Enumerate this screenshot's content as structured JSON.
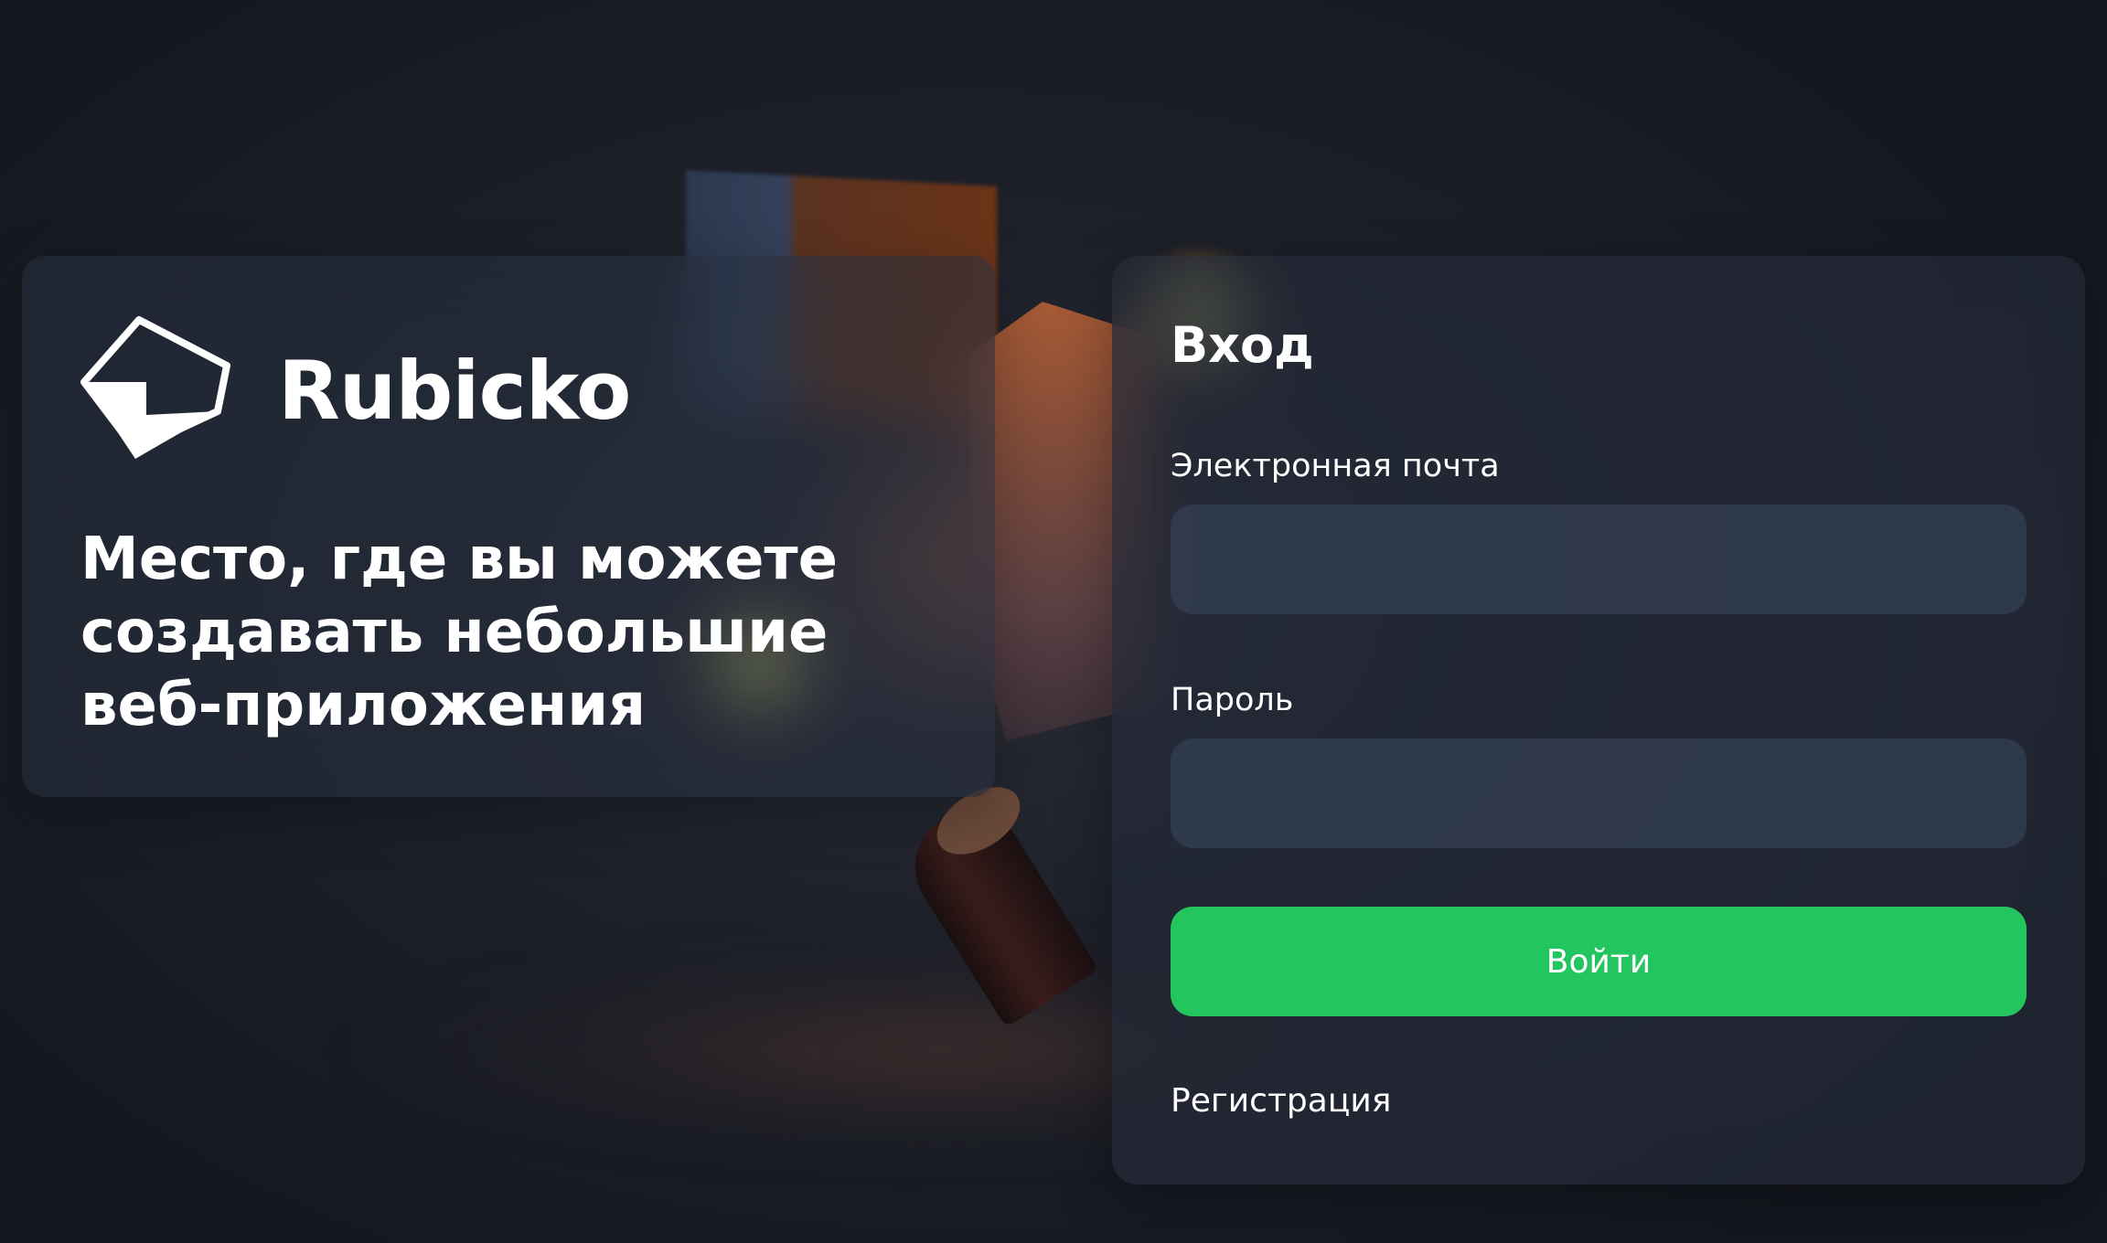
{
  "brand": {
    "name": "Rubicko",
    "tagline": "Место, где вы можете создавать небольшие веб-приложения"
  },
  "login": {
    "title": "Вход",
    "email_label": "Электронная почта",
    "email_value": "",
    "password_label": "Пароль",
    "password_value": "",
    "submit_label": "Войти",
    "register_label": "Регистрация"
  },
  "colors": {
    "accent": "#22c55e",
    "background": "#1d2029",
    "panel": "#282f3d",
    "input": "#334054"
  },
  "icons": {
    "logo": "rubicko-logo-icon"
  }
}
